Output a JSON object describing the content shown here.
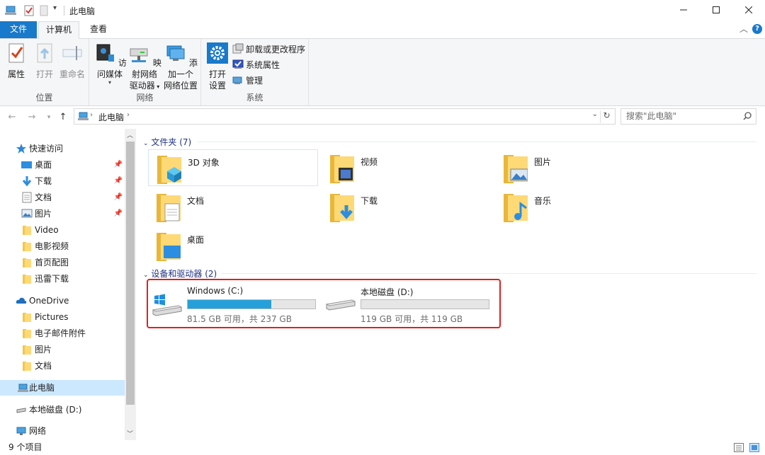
{
  "window": {
    "title": "此电脑",
    "min_icon": "minimize-icon",
    "max_icon": "maximize-icon",
    "close_icon": "close-icon"
  },
  "tabs": {
    "file": "文件",
    "computer": "计算机",
    "view": "查看"
  },
  "ribbon": {
    "location": {
      "label": "位置",
      "properties": "属性",
      "open": "打开",
      "rename": "重命名"
    },
    "network": {
      "label": "网络",
      "access_media": "访问媒体",
      "map_drive_line1": "映射网络",
      "map_drive_line2": "驱动器",
      "add_location_line1": "添加一个",
      "add_location_line2": "网络位置"
    },
    "system": {
      "label": "系统",
      "open_settings_line1": "打开",
      "open_settings_line2": "设置",
      "uninstall": "卸载或更改程序",
      "sys_props": "系统属性",
      "manage": "管理"
    }
  },
  "address": {
    "path": "此电脑",
    "search_placeholder": "搜索\"此电脑\""
  },
  "nav": {
    "quick_access": "快速访问",
    "qa_items": [
      "桌面",
      "下载",
      "文档",
      "图片",
      "Video",
      "电影视频",
      "首页配图",
      "迅雷下载"
    ],
    "onedrive": "OneDrive",
    "od_items": [
      "Pictures",
      "电子邮件附件",
      "图片",
      "文档"
    ],
    "this_pc": "此电脑",
    "local_disk": "本地磁盘 (D:)",
    "network": "网络"
  },
  "content": {
    "folders_header": "文件夹 (7)",
    "folders": [
      "3D 对象",
      "视频",
      "图片",
      "文档",
      "下载",
      "音乐",
      "桌面"
    ],
    "drives_header": "设备和驱动器 (2)",
    "drives": [
      {
        "name": "Windows (C:)",
        "free": "81.5 GB 可用，共 237 GB",
        "used_fraction": 0.656
      },
      {
        "name": "本地磁盘 (D:)",
        "free": "119 GB 可用，共 119 GB",
        "used_fraction": 0.0
      }
    ]
  },
  "status": {
    "count": "9 个项目"
  },
  "colors": {
    "accent": "#1979ca",
    "drive_bar": "#26a0da",
    "highlight_box": "#e02020",
    "selection": "#cce8ff"
  }
}
